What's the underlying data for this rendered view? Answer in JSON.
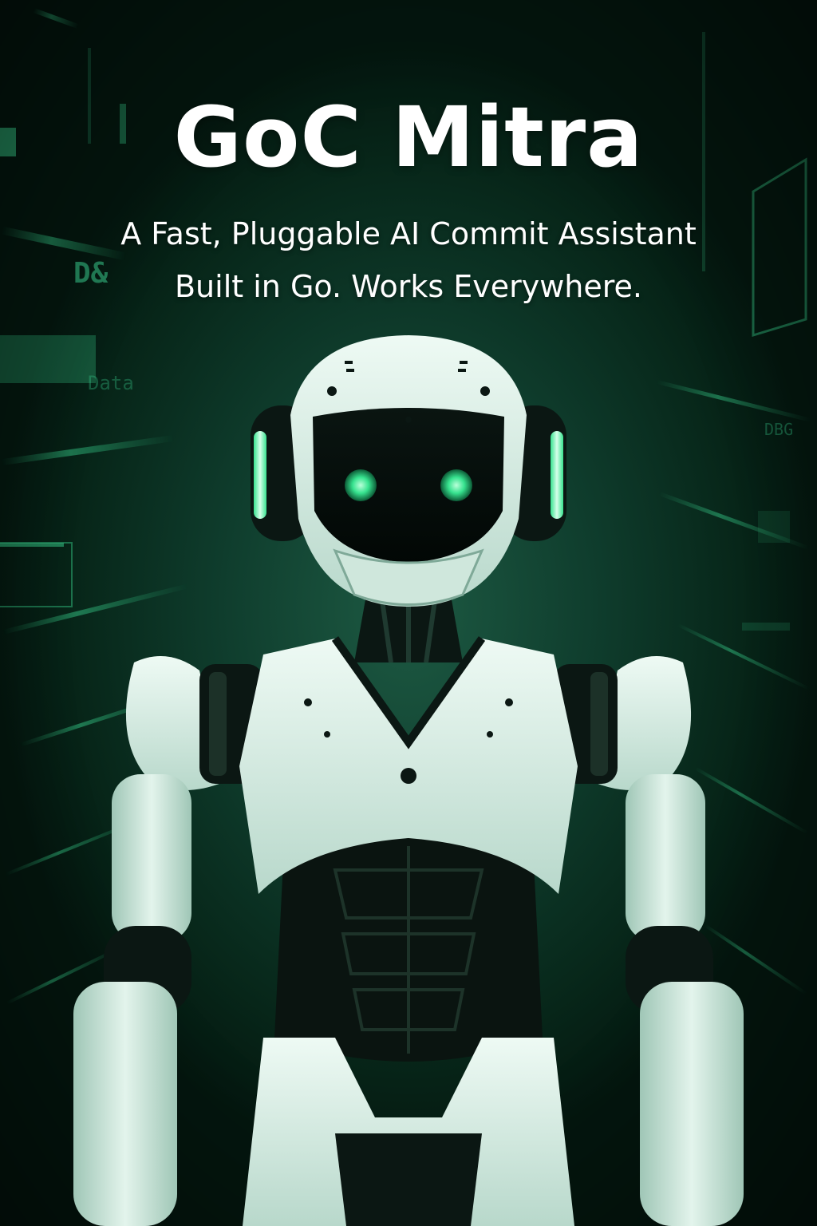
{
  "poster": {
    "title": "GoC Mitra",
    "subtitle_line1": "A Fast, Pluggable AI Commit Assistant",
    "subtitle_line2": "Built in Go. Works Everywhere."
  },
  "background_text": {
    "left_glyph": "D&",
    "left_code": "Data",
    "right_code": "DBG"
  },
  "colors": {
    "background_dark": "#062a1f",
    "background_mid": "#1d5a43",
    "accent_green": "#37e38f",
    "robot_shell": "#dff3ea",
    "robot_joint": "#0b1713",
    "text": "#ffffff"
  },
  "illustration": {
    "subject": "robot-icon"
  }
}
